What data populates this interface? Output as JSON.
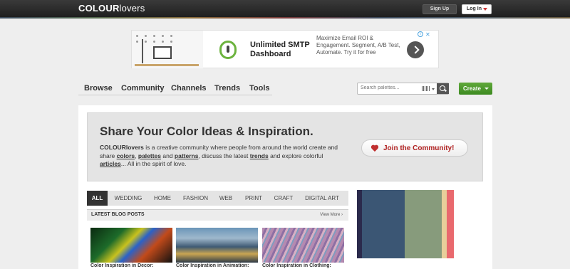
{
  "topbar": {
    "logo_main": "COLOUR",
    "logo_rest": "lovers",
    "signup": "Sign Up",
    "login": "Log In"
  },
  "ad": {
    "title": "Unlimited SMTP Dashboard",
    "text": "Maximize Email ROI & Engagement. Segment, A/B Test, Automate. Try it for free",
    "close": "✕",
    "info": "i"
  },
  "nav": {
    "items": [
      "Browse",
      "Community",
      "Channels",
      "Trends",
      "Tools"
    ]
  },
  "search": {
    "placeholder": "Search palettes..."
  },
  "create": {
    "label": "Create"
  },
  "hero": {
    "title": "Share Your Color Ideas & Inspiration.",
    "brand": "COLOURlovers",
    "t1": " is a creative community where people from around the world create and share ",
    "colors": "colors",
    "t2": ", ",
    "palettes": "palettes",
    "t3": " and ",
    "patterns": "patterns",
    "t4": ", discuss the latest ",
    "trends": "trends",
    "t5": " and explore colorful ",
    "articles": "articles",
    "t6": "... All in the spirit of love.",
    "join": "Join the Community!"
  },
  "tabs": [
    "ALL",
    "WEDDING",
    "HOME",
    "FASHION",
    "WEB",
    "PRINT",
    "CRAFT",
    "DIGITAL ART"
  ],
  "blog": {
    "heading": "LATEST BLOG POSTS",
    "more": "View More ›",
    "posts": [
      {
        "title": "Color Inspiration in Decor:"
      },
      {
        "title": "Color Inspiration in Animation:"
      },
      {
        "title": "Color Inspiration in Clothing:"
      }
    ]
  },
  "palette": {
    "colors": [
      "#2b2a4c",
      "#3b5674",
      "#879b7c",
      "#e8cf9a",
      "#e9696e"
    ]
  }
}
